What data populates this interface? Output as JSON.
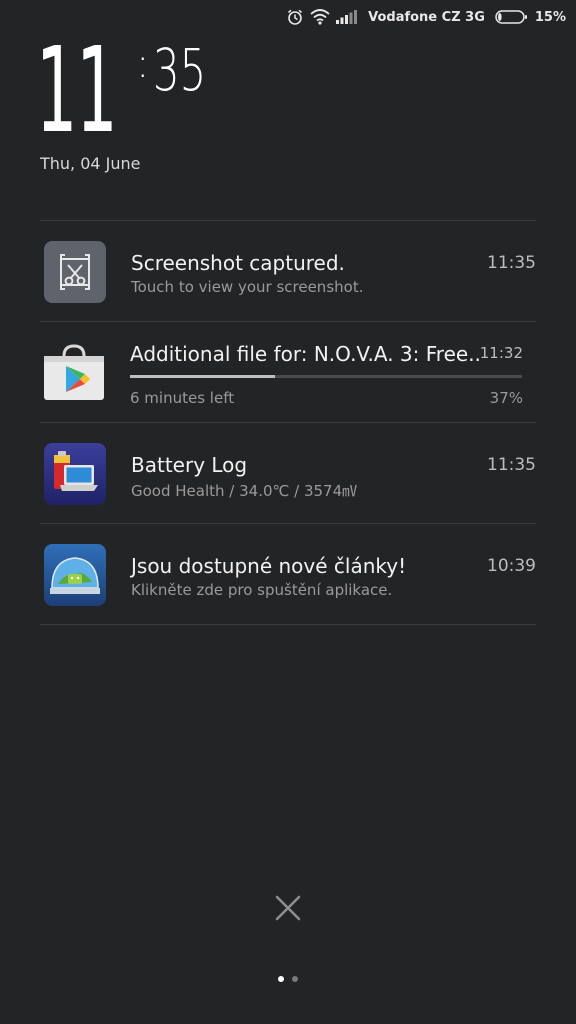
{
  "status_bar": {
    "carrier": "Vodafone CZ 3G",
    "battery_percent": "15%",
    "battery_level": 0.15,
    "icons": [
      "alarm-icon",
      "wifi-icon",
      "signal-icon",
      "battery-icon"
    ]
  },
  "lockscreen": {
    "hour": "11",
    "colon": ":",
    "minute": "35",
    "date": "Thu, 04 June"
  },
  "notifications": [
    {
      "icon": "screenshot-icon",
      "title": "Screenshot captured.",
      "subtitle": "Touch to view your screenshot.",
      "time": "11:35"
    },
    {
      "icon": "play-store-icon",
      "title": "Additional file for: N.O.V.A. 3: Free..",
      "subtitle": "6 minutes left",
      "time": "11:32",
      "percent": "37%",
      "progress": 0.37
    },
    {
      "icon": "battery-log-icon",
      "title": "Battery Log",
      "subtitle": "Good Health / 34.0℃ / 3574㎷",
      "time": "11:35"
    },
    {
      "icon": "news-app-icon",
      "title": "Jsou dostupné nové články!",
      "subtitle": "Klikněte zde pro spuštění aplikace.",
      "time": "10:39"
    }
  ],
  "colors": {
    "background": "#232426",
    "divider": "#3a3b3e",
    "progress": "#bfbfbf"
  },
  "footer": {
    "clear_icon": "close-icon",
    "pages": 2,
    "active_page": 1
  }
}
